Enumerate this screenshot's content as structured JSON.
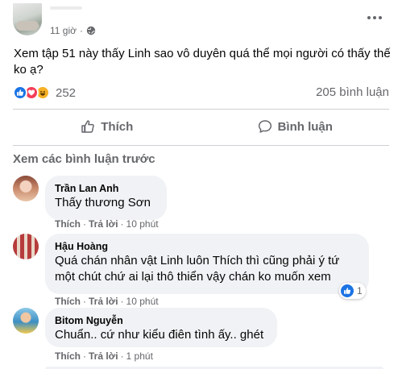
{
  "post": {
    "time": "11 giờ",
    "privacy_icon": "globe-icon",
    "text": "Xem tập 51 này thấy Linh sao vô duyên quá thể mọi người có thấy thế ko ạ?",
    "reactions": [
      "like",
      "love",
      "haha"
    ],
    "reaction_count": "252",
    "comment_count": "205 bình luận"
  },
  "actions": {
    "like_label": "Thích",
    "comment_label": "Bình luận"
  },
  "comments_section": {
    "view_previous": "Xem các bình luận trước",
    "comments": [
      {
        "author": "Trần Lan Anh",
        "text": "Thấy thương Sơn",
        "like": "Thích",
        "reply": "Trả lời",
        "time": "10 phút"
      },
      {
        "author": "Hậu Hoàng",
        "text": "Quá chán nhân vật Linh luôn Thích thì cũng phải ý tứ một chút chứ ai lại thô thiển vậy chán ko muốn xem",
        "like": "Thích",
        "reply": "Trả lời",
        "time": "10 phút",
        "reaction_count": "1"
      },
      {
        "author": "Bitom Nguyễn",
        "text": "Chuẩn.. cứ như kiểu điên tình ấy.. ghét",
        "like": "Thích",
        "reply": "Trả lời",
        "time": "1 phút"
      }
    ]
  },
  "colors": {
    "accent_blue": "#1b74e4",
    "love_red": "#f33e58",
    "haha_yellow": "#f7b125",
    "secondary_text": "#65676b",
    "bubble_bg": "#f0f2f5"
  }
}
